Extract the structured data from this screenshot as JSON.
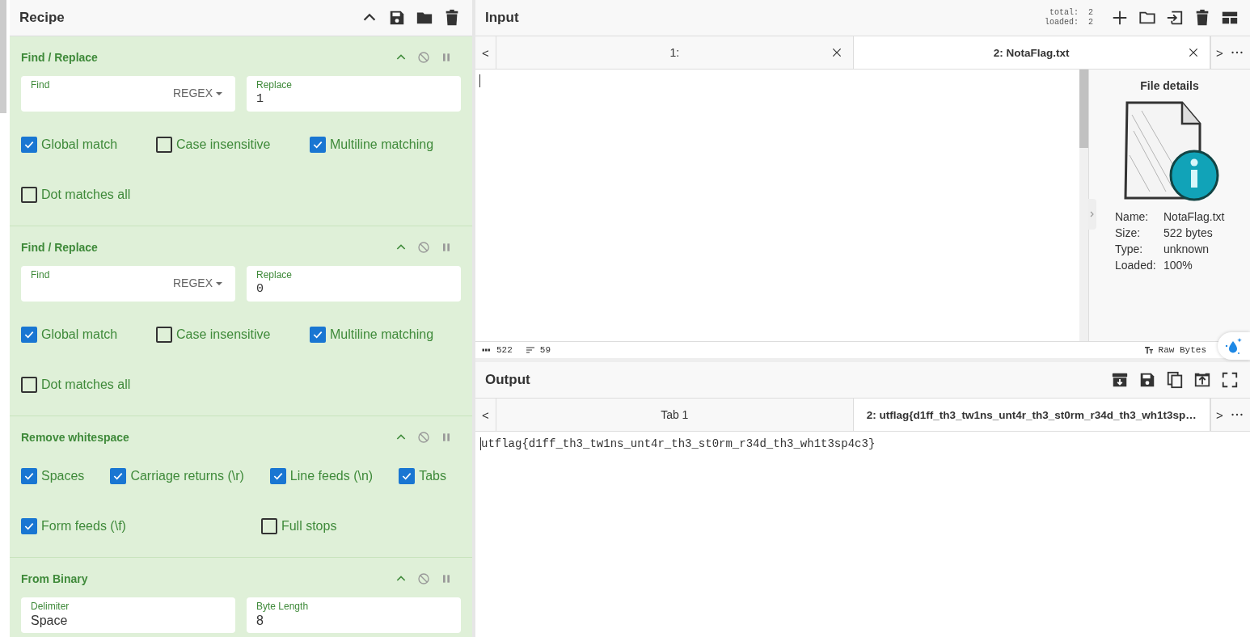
{
  "recipe": {
    "title": "Recipe",
    "operations": [
      {
        "kind": "find_replace",
        "title": "Find / Replace",
        "fields": [
          {
            "kind": "regex",
            "label": "Find",
            "dropdown": "REGEX"
          },
          {
            "kind": "text",
            "label": "Replace",
            "value": "1"
          }
        ],
        "option_rows": [
          [
            {
              "label": "Global match",
              "checked": true
            },
            {
              "label": "Case insensitive",
              "checked": false
            },
            {
              "label": "Multiline matching",
              "checked": true
            }
          ],
          [
            {
              "label": "Dot matches all",
              "checked": false
            }
          ]
        ]
      },
      {
        "kind": "find_replace",
        "title": "Find / Replace",
        "fields": [
          {
            "kind": "regex",
            "label": "Find",
            "dropdown": "REGEX"
          },
          {
            "kind": "text",
            "label": "Replace",
            "value": "0"
          }
        ],
        "option_rows": [
          [
            {
              "label": "Global match",
              "checked": true
            },
            {
              "label": "Case insensitive",
              "checked": false
            },
            {
              "label": "Multiline matching",
              "checked": true
            }
          ],
          [
            {
              "label": "Dot matches all",
              "checked": false
            }
          ]
        ]
      },
      {
        "kind": "remove_whitespace",
        "title": "Remove whitespace",
        "option_rows": [
          [
            {
              "label": "Spaces",
              "checked": true
            },
            {
              "label": "Carriage returns (\\r)",
              "checked": true
            },
            {
              "label": "Line feeds (\\n)",
              "checked": true
            },
            {
              "label": "Tabs",
              "checked": true
            }
          ],
          [
            {
              "label": "Form feeds (\\f)",
              "checked": true
            },
            {
              "label": "Full stops",
              "checked": false
            }
          ]
        ]
      },
      {
        "kind": "from_binary",
        "title": "From Binary",
        "fields": [
          {
            "kind": "select",
            "label": "Delimiter",
            "value": "Space"
          },
          {
            "kind": "number",
            "label": "Byte Length",
            "value": "8"
          }
        ]
      }
    ]
  },
  "input": {
    "title": "Input",
    "total_label": "total:",
    "total": "2",
    "loaded_label": "loaded:",
    "loaded": "2",
    "prev": "<",
    "next": ">",
    "tabs": [
      {
        "label": "1:",
        "selected": false
      },
      {
        "label": "2: NotaFlag.txt",
        "selected": true
      }
    ],
    "file_details": {
      "title": "File details",
      "rows": [
        {
          "label": "Name:",
          "value": "NotaFlag.txt"
        },
        {
          "label": "Size:",
          "value": "522 bytes"
        },
        {
          "label": "Type:",
          "value": "unknown"
        },
        {
          "label": "Loaded:",
          "value": "100%"
        }
      ]
    },
    "status_bar": {
      "length": "522",
      "lines": "59",
      "format": "Raw Bytes"
    }
  },
  "output": {
    "title": "Output",
    "prev": "<",
    "next": ">",
    "tabs": [
      {
        "label": "Tab 1",
        "selected": false
      },
      {
        "label": "2: utflag{d1ff_th3_tw1ns_unt4r_th3_st0rm_r34d_th3_wh1t3sp…",
        "selected": true
      }
    ],
    "text": "utflag{d1ff_th3_tw1ns_unt4r_th3_st0rm_r34d_th3_wh1t3sp4c3}"
  }
}
